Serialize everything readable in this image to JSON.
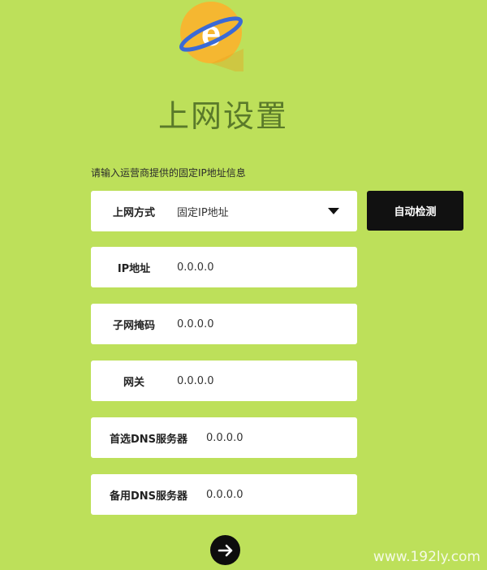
{
  "page": {
    "title": "上网设置",
    "subtitle": "请输入运营商提供的固定IP地址信息"
  },
  "fields": {
    "connection_type": {
      "label": "上网方式",
      "value": "固定IP地址"
    },
    "ip_address": {
      "label": "IP地址",
      "value": "0.0.0.0"
    },
    "subnet_mask": {
      "label": "子网掩码",
      "value": "0.0.0.0"
    },
    "gateway": {
      "label": "网关",
      "value": "0.0.0.0"
    },
    "primary_dns": {
      "label": "首选DNS服务器",
      "value": "0.0.0.0"
    },
    "secondary_dns": {
      "label": "备用DNS服务器",
      "value": "0.0.0.0"
    }
  },
  "buttons": {
    "auto_detect": "自动检测"
  },
  "watermark": "www.192ly.com",
  "colors": {
    "background": "#bde05a",
    "title": "#5a7a2a",
    "logo_circle": "#f5b731",
    "button": "#111111"
  },
  "icons": {
    "logo": "internet-explorer-style-logo",
    "dropdown": "caret-down-icon",
    "next": "arrow-right-icon"
  }
}
